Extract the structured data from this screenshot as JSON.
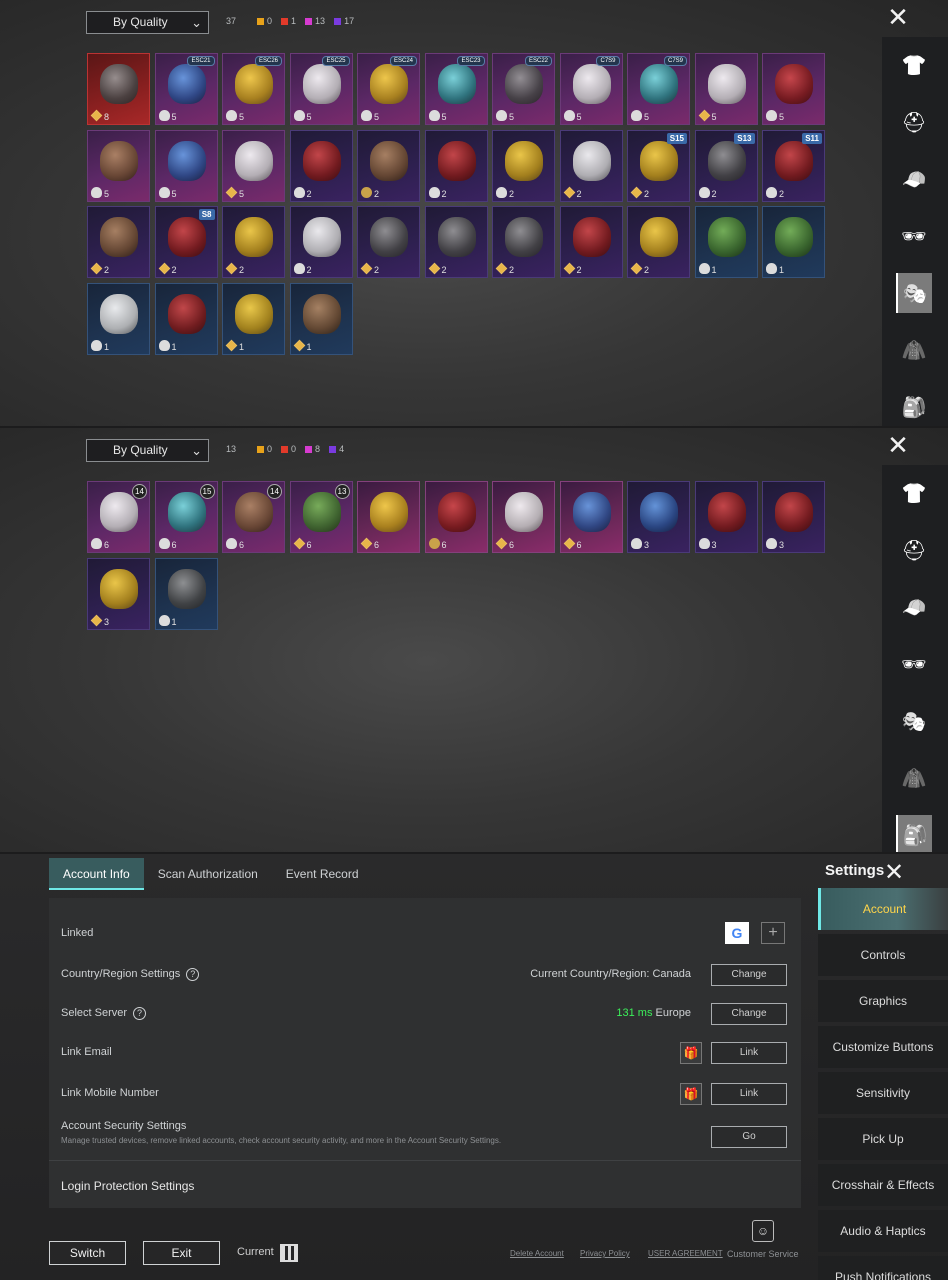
{
  "panel1": {
    "sort_label": "By Quality",
    "total": "37",
    "counts": [
      {
        "value": "0",
        "color": "#e8a21a"
      },
      {
        "value": "1",
        "color": "#e23a2a"
      },
      {
        "value": "13",
        "color": "#d63bd0"
      },
      {
        "value": "17",
        "color": "#7a3be0"
      }
    ],
    "items": [
      {
        "count": "8",
        "q": "red",
        "art": "",
        "bicon": "coin",
        "tag": ""
      },
      {
        "count": "5",
        "q": "purple",
        "art": "blue",
        "bicon": "cloud",
        "tag": "ESC21"
      },
      {
        "count": "5",
        "q": "purple",
        "art": "gold",
        "bicon": "cloud",
        "tag": "ESC26"
      },
      {
        "count": "5",
        "q": "purple",
        "art": "white",
        "bicon": "cloud",
        "tag": "ESC25"
      },
      {
        "count": "5",
        "q": "purple",
        "art": "gold",
        "bicon": "cloud",
        "tag": "ESC24"
      },
      {
        "count": "5",
        "q": "purple",
        "art": "teal",
        "bicon": "cloud",
        "tag": "ESC23"
      },
      {
        "count": "5",
        "q": "purple",
        "art": "",
        "bicon": "cloud",
        "tag": "ESC22"
      },
      {
        "count": "5",
        "q": "purple",
        "art": "white",
        "bicon": "cloud",
        "tag": "C7S9"
      },
      {
        "count": "5",
        "q": "purple",
        "art": "teal",
        "bicon": "cloud",
        "tag": "C7S9"
      },
      {
        "count": "5",
        "q": "purple",
        "art": "white",
        "bicon": "coin",
        "tag": ""
      },
      {
        "count": "5",
        "q": "purple",
        "art": "red",
        "bicon": "cloud",
        "tag": ""
      },
      {
        "count": "5",
        "q": "purple",
        "art": "brown",
        "bicon": "cloud",
        "tag": ""
      },
      {
        "count": "5",
        "q": "purple",
        "art": "blue",
        "bicon": "cloud",
        "tag": ""
      },
      {
        "count": "5",
        "q": "purple",
        "art": "white",
        "bicon": "coin",
        "tag": ""
      },
      {
        "count": "2",
        "q": "violet",
        "art": "red",
        "bicon": "cloud",
        "tag": ""
      },
      {
        "count": "2",
        "q": "violet",
        "art": "brown",
        "bicon": "gold",
        "tag": ""
      },
      {
        "count": "2",
        "q": "violet",
        "art": "red",
        "bicon": "cloud",
        "tag": ""
      },
      {
        "count": "2",
        "q": "violet",
        "art": "gold",
        "bicon": "cloud",
        "tag": ""
      },
      {
        "count": "2",
        "q": "violet",
        "art": "white",
        "bicon": "coin",
        "tag": ""
      },
      {
        "count": "2",
        "q": "violet",
        "art": "gold",
        "bicon": "coin",
        "tag": "S15"
      },
      {
        "count": "2",
        "q": "violet",
        "art": "",
        "bicon": "cloud",
        "tag": "S13"
      },
      {
        "count": "2",
        "q": "violet",
        "art": "red",
        "bicon": "cloud",
        "tag": "S11"
      },
      {
        "count": "2",
        "q": "violet",
        "art": "brown",
        "bicon": "coin",
        "tag": ""
      },
      {
        "count": "2",
        "q": "violet",
        "art": "red",
        "bicon": "coin",
        "tag": "S8"
      },
      {
        "count": "2",
        "q": "violet",
        "art": "gold",
        "bicon": "coin",
        "tag": ""
      },
      {
        "count": "2",
        "q": "violet",
        "art": "white",
        "bicon": "cloud",
        "tag": ""
      },
      {
        "count": "2",
        "q": "violet",
        "art": "",
        "bicon": "coin",
        "tag": ""
      },
      {
        "count": "2",
        "q": "violet",
        "art": "",
        "bicon": "coin",
        "tag": ""
      },
      {
        "count": "2",
        "q": "violet",
        "art": "",
        "bicon": "coin",
        "tag": ""
      },
      {
        "count": "2",
        "q": "violet",
        "art": "red",
        "bicon": "coin",
        "tag": ""
      },
      {
        "count": "2",
        "q": "violet",
        "art": "gold",
        "bicon": "coin",
        "tag": ""
      },
      {
        "count": "1",
        "q": "blue",
        "art": "green",
        "bicon": "cloud",
        "tag": ""
      },
      {
        "count": "1",
        "q": "blue",
        "art": "green",
        "bicon": "cloud",
        "tag": ""
      },
      {
        "count": "1",
        "q": "blue",
        "art": "white",
        "bicon": "cloud",
        "tag": ""
      },
      {
        "count": "1",
        "q": "blue",
        "art": "red",
        "bicon": "cloud",
        "tag": ""
      },
      {
        "count": "1",
        "q": "blue",
        "art": "gold",
        "bicon": "coin",
        "tag": ""
      },
      {
        "count": "1",
        "q": "blue",
        "art": "brown",
        "bicon": "coin",
        "tag": ""
      }
    ],
    "side_icons": [
      "shirt-icon",
      "helmet-icon",
      "cap-icon",
      "glasses-icon",
      "mask-icon",
      "jacket-icon",
      "backpack-icon"
    ],
    "side_active": 4
  },
  "panel2": {
    "sort_label": "By Quality",
    "total": "13",
    "counts": [
      {
        "value": "0",
        "color": "#e8a21a"
      },
      {
        "value": "0",
        "color": "#e23a2a"
      },
      {
        "value": "8",
        "color": "#d63bd0"
      },
      {
        "value": "4",
        "color": "#7a3be0"
      }
    ],
    "items": [
      {
        "count": "6",
        "q": "purple",
        "art": "white",
        "bicon": "cloud",
        "tag": "14"
      },
      {
        "count": "6",
        "q": "purple",
        "art": "teal",
        "bicon": "cloud",
        "tag": "15"
      },
      {
        "count": "6",
        "q": "purple",
        "art": "brown",
        "bicon": "cloud",
        "tag": "14"
      },
      {
        "count": "6",
        "q": "purple",
        "art": "green",
        "bicon": "coin",
        "tag": "13"
      },
      {
        "count": "6",
        "q": "pink",
        "art": "gold",
        "bicon": "coin",
        "tag": ""
      },
      {
        "count": "6",
        "q": "pink",
        "art": "red",
        "bicon": "gold",
        "tag": ""
      },
      {
        "count": "6",
        "q": "pink",
        "art": "white",
        "bicon": "coin",
        "tag": ""
      },
      {
        "count": "6",
        "q": "pink",
        "art": "blue",
        "bicon": "coin",
        "tag": ""
      },
      {
        "count": "3",
        "q": "violet",
        "art": "blue",
        "bicon": "cloud",
        "tag": ""
      },
      {
        "count": "3",
        "q": "violet",
        "art": "red",
        "bicon": "cloud",
        "tag": ""
      },
      {
        "count": "3",
        "q": "violet",
        "art": "red",
        "bicon": "cloud",
        "tag": ""
      },
      {
        "count": "3",
        "q": "violet",
        "art": "gold",
        "bicon": "coin",
        "tag": ""
      },
      {
        "count": "1",
        "q": "blue",
        "art": "",
        "bicon": "cloud",
        "tag": ""
      }
    ],
    "side_icons": [
      "shirt-icon",
      "helmet-icon",
      "cap-icon",
      "glasses-icon",
      "mask-icon",
      "jacket-icon",
      "backpack-icon"
    ],
    "side_active": 6
  },
  "panel3": {
    "tabs": [
      "Account Info",
      "Scan Authorization",
      "Event Record"
    ],
    "title": "Settings",
    "rows": {
      "linked": "Linked",
      "region": "Country/Region Settings",
      "region_value": "Current Country/Region: Canada",
      "region_btn": "Change",
      "server": "Select Server",
      "ping": "131 ms",
      "server_value": "Europe",
      "server_btn": "Change",
      "email": "Link Email",
      "email_btn": "Link",
      "mobile": "Link Mobile Number",
      "mobile_btn": "Link",
      "security": "Account Security Settings",
      "security_sub": "Manage trusted devices, remove linked accounts, check account security activity, and more in the Account Security Settings.",
      "security_btn": "Go",
      "login_protection": "Login Protection Settings"
    },
    "nav": [
      "Account",
      "Controls",
      "Graphics",
      "Customize Buttons",
      "Sensitivity",
      "Pick Up",
      "Crosshair & Effects",
      "Audio & Haptics",
      "Push Notifications"
    ],
    "nav_active": 0,
    "footer": {
      "switch": "Switch",
      "exit": "Exit",
      "current": "Current",
      "delete": "Delete Account",
      "privacy": "Privacy Policy",
      "agreement": "USER AGREEMENT",
      "service": "Customer Service"
    }
  }
}
